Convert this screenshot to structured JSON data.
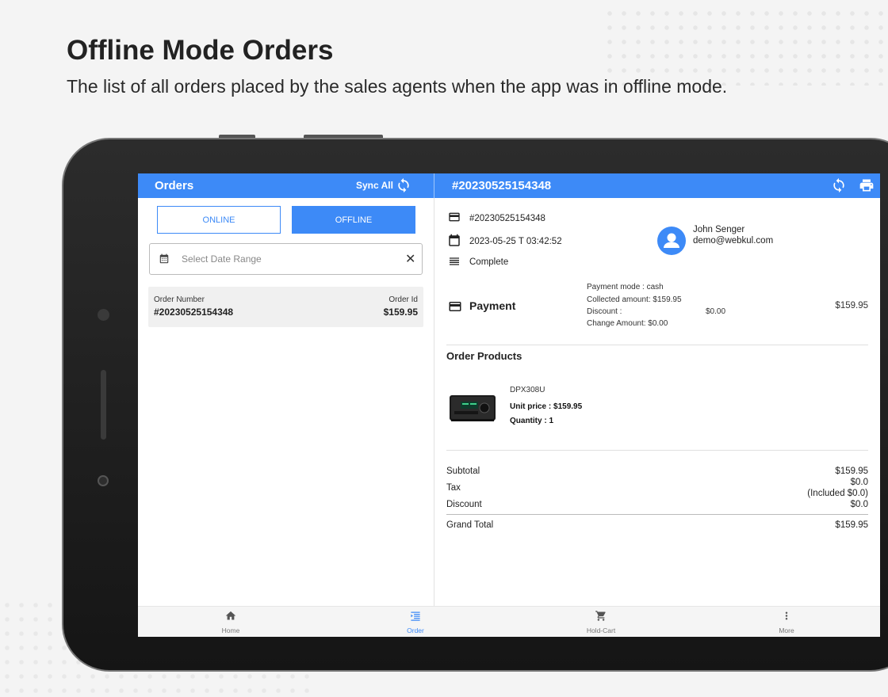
{
  "header": {
    "title": "Offline Mode Orders",
    "subtitle": "The list of all orders placed by the sales agents when the app was in offline mode."
  },
  "colors": {
    "primary": "#3d8af7",
    "background": "#f4f4f4"
  },
  "appbar": {
    "left_title": "Orders",
    "sync_all_label": "Sync All",
    "order_title": "#20230525154348",
    "icons": [
      "sync-icon",
      "refresh-icon",
      "print-icon"
    ]
  },
  "left": {
    "tabs": {
      "online": "ONLINE",
      "offline": "OFFLINE",
      "selected": "OFFLINE"
    },
    "date_range": {
      "placeholder": "Select Date Range",
      "value": ""
    },
    "orders": [
      {
        "label_left": "Order Number",
        "label_right": "Order Id",
        "number": "#20230525154348",
        "amount": "$159.95"
      }
    ]
  },
  "detail": {
    "order_number": "#20230525154348",
    "datetime": "2023-05-25 T 03:42:52",
    "status": "Complete",
    "customer": {
      "name": "John Senger",
      "email": "demo@webkul.com"
    },
    "payment": {
      "title": "Payment",
      "mode": "Payment mode : cash",
      "collected": "Collected amount: $159.95",
      "discount_label": "Discount :",
      "discount_value": "$0.00",
      "change": "Change Amount: $0.00",
      "total": "$159.95"
    },
    "products_title": "Order Products",
    "products": [
      {
        "name": "DPX308U",
        "unit_price_label": "Unit price : ",
        "unit_price": "$159.95",
        "quantity_label": "Quantity : ",
        "quantity": "1"
      }
    ],
    "summary": {
      "subtotal_label": "Subtotal",
      "subtotal": "$159.95",
      "tax_label": "Tax",
      "tax": "$0.0",
      "tax_note": "(Included $0.0)",
      "discount_label": "Discount",
      "discount": "$0.0",
      "grand_total_label": "Grand Total",
      "grand_total": "$159.95"
    }
  },
  "bottom_nav": [
    {
      "label": "Home",
      "icon": "home-icon",
      "active": false
    },
    {
      "label": "Order",
      "icon": "order-list-icon",
      "active": true
    },
    {
      "label": "Hold-Cart",
      "icon": "cart-icon",
      "active": false
    },
    {
      "label": "More",
      "icon": "more-vert-icon",
      "active": false
    }
  ]
}
